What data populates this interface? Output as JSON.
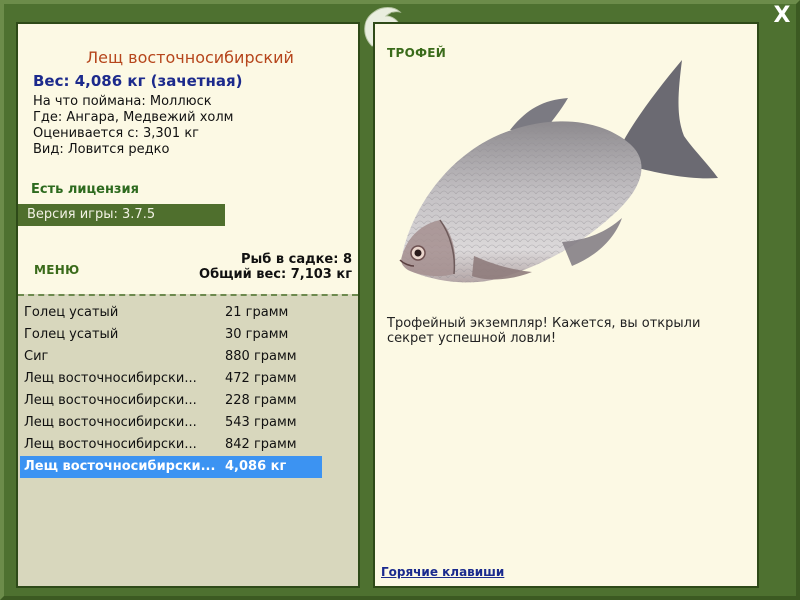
{
  "window": {
    "close_label": "X"
  },
  "left_panel": {
    "fish_name": "Лещ восточносибирский",
    "weight_line": "Вес: 4,086 кг (зачетная)",
    "info": [
      "На что поймана: Моллюск",
      "Где: Ангара, Медвежий холм",
      "Оценивается с: 3,301 кг",
      "Вид: Ловится редко"
    ],
    "license": "Есть лицензия",
    "version": "Версия игры: 3.7.5",
    "menu_label": "МЕНЮ",
    "stats": {
      "count": "Рыб в садке: 8",
      "total": "Общий вес: 7,103 кг"
    }
  },
  "catch_list": [
    {
      "name": "Голец усатый",
      "weight": "21 грамм"
    },
    {
      "name": "Голец усатый",
      "weight": "30 грамм"
    },
    {
      "name": "Сиг",
      "weight": "880 грамм"
    },
    {
      "name": "Лещ восточносибирски...",
      "weight": "472 грамм"
    },
    {
      "name": "Лещ восточносибирски...",
      "weight": "228 грамм"
    },
    {
      "name": "Лещ восточносибирски...",
      "weight": "543 грамм"
    },
    {
      "name": "Лещ восточносибирски...",
      "weight": "842 грамм"
    },
    {
      "name": "Лещ восточносибирски...",
      "weight": "4,086 кг"
    }
  ],
  "selected_index": 7,
  "right_panel": {
    "trophy_label": "ТРОФЕЙ",
    "trophy_text": "Трофейный экземпляр! Кажется, вы открыли секрет успешной ловли!",
    "hotkeys": "Горячие клавиши"
  },
  "colors": {
    "frame": "#4e7130",
    "panel": "#fcf9e4",
    "list_bg": "#d8d7bd",
    "selected": "#3c93f2",
    "title": "#b6461c",
    "weight": "#1c2a8c",
    "accent_green": "#3a6b1a"
  },
  "icons": {
    "emblem": "fish-emblem-icon",
    "close": "close-icon"
  }
}
